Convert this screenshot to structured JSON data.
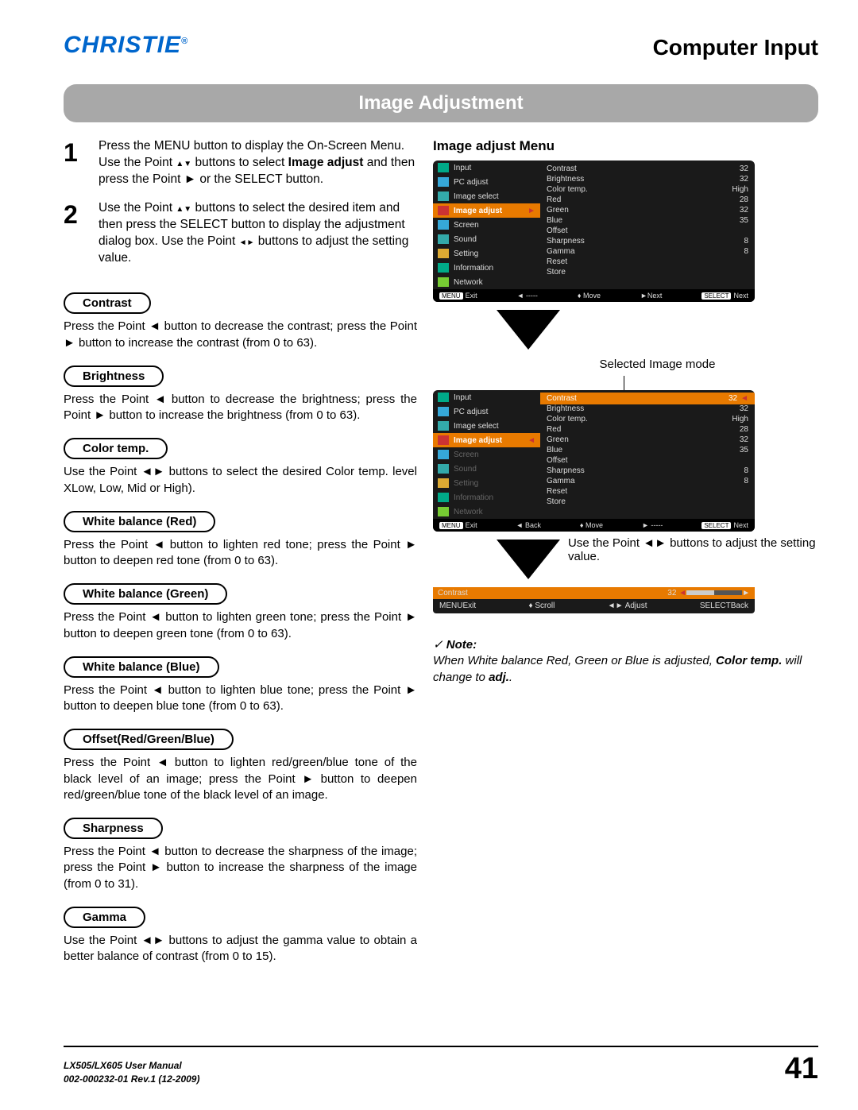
{
  "header": {
    "logo": "CHRISTIE",
    "title": "Computer Input"
  },
  "section_title": "Image Adjustment",
  "steps": [
    {
      "num": "1",
      "pre": "Press the MENU button to display the On-Screen Menu. Use the Point ",
      "mid": " buttons to select ",
      "bold": "Image adjust",
      "post": " and then press the Point ► or the SELECT button."
    },
    {
      "num": "2",
      "pre": "Use the Point ",
      "mid": " buttons to select the desired item and then press the SELECT button to display the adjustment dialog box. Use the Point ",
      "post": " buttons to adjust the setting value."
    }
  ],
  "adjustments": [
    {
      "label": "Contrast",
      "desc": "Press the Point ◄ button to decrease the contrast; press the Point ► button to increase the contrast (from 0 to 63)."
    },
    {
      "label": "Brightness",
      "desc": "Press the Point ◄ button to decrease the brightness; press the Point ► button to increase the brightness (from 0 to 63)."
    },
    {
      "label": "Color temp.",
      "desc": "Use the Point ◄► buttons to select the desired Color temp. level XLow, Low, Mid or High)."
    },
    {
      "label": "White balance (Red)",
      "desc": "Press the Point ◄ button to lighten red tone; press the Point ► button to deepen red tone (from 0 to 63)."
    },
    {
      "label": "White balance (Green)",
      "desc": "Press the Point ◄ button to lighten green tone; press the Point ► button to deepen green tone (from 0 to 63)."
    },
    {
      "label": "White balance (Blue)",
      "desc": "Press the Point ◄ button to lighten blue tone; press the Point ► button to deepen blue tone (from 0 to 63)."
    },
    {
      "label": "Offset(Red/Green/Blue)",
      "desc": "Press the Point ◄ button to lighten red/green/blue tone of the black level of an image; press the Point ► button to deepen red/green/blue tone of the black level of an image."
    },
    {
      "label": "Sharpness",
      "desc": "Press the Point ◄ button to decrease the sharpness of the image; press the Point ► button to increase the sharpness of the image (from 0 to 31)."
    },
    {
      "label": "Gamma",
      "desc": "Use the Point ◄► buttons to adjust the gamma value to obtain a better balance of contrast (from 0 to 15)."
    }
  ],
  "right": {
    "heading": "Image adjust Menu",
    "menu_items": [
      "Input",
      "PC adjust",
      "Image select",
      "Image adjust",
      "Screen",
      "Sound",
      "Setting",
      "Information",
      "Network"
    ],
    "params": [
      {
        "name": "Contrast",
        "val": "32"
      },
      {
        "name": "Brightness",
        "val": "32"
      },
      {
        "name": "Color temp.",
        "val": "High"
      },
      {
        "name": "Red",
        "val": "28"
      },
      {
        "name": "Green",
        "val": "32"
      },
      {
        "name": "Blue",
        "val": "35"
      },
      {
        "name": "Offset",
        "val": ""
      },
      {
        "name": "Sharpness",
        "val": "8"
      },
      {
        "name": "Gamma",
        "val": "8"
      },
      {
        "name": "Reset",
        "val": ""
      },
      {
        "name": "Store",
        "val": ""
      }
    ],
    "hint1": {
      "exitk": "MENU",
      "exit": "Exit",
      "back": "◄ -----",
      "move": "♦ Move",
      "next": "►Next",
      "selk": "SELECT",
      "sel": "Next"
    },
    "hint2": {
      "exitk": "MENU",
      "exit": "Exit",
      "back": "◄ Back",
      "move": "♦ Move",
      "next": "► -----",
      "selk": "SELECT",
      "sel": "Next"
    },
    "caption1": "Selected Image mode",
    "caption2": "Use the Point ◄► buttons to adjust the setting value.",
    "slider": {
      "label": "Contrast",
      "val": "32"
    },
    "slider_hint": {
      "exitk": "MENU",
      "exit": "Exit",
      "scroll": "♦ Scroll",
      "adjust": "◄► Adjust",
      "backk": "SELECT",
      "back": "Back"
    }
  },
  "note": {
    "heading": "Note:",
    "body_pre": "When White balance Red, Green or Blue is adjusted, ",
    "body_bold": "Color temp.",
    "body_post": " will change to ",
    "body_bold2": "adj.",
    "body_end": "."
  },
  "footer": {
    "line1": "LX505/LX605 User Manual",
    "line2": "002-000232-01 Rev.1 (12-2009)",
    "page": "41"
  }
}
